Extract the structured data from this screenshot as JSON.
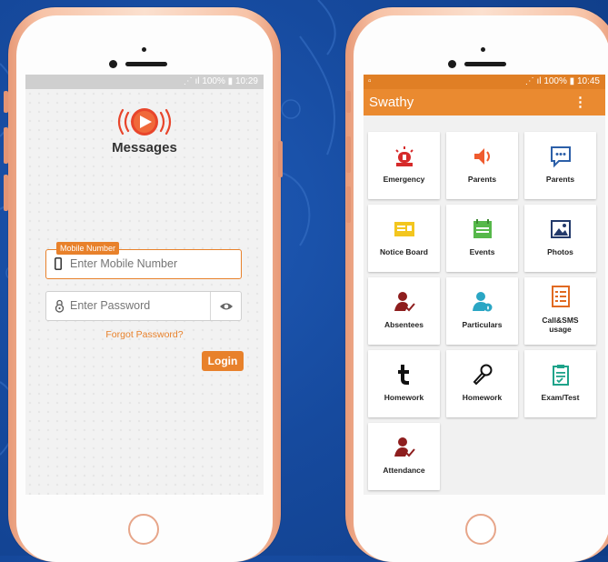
{
  "login_phone": {
    "status": {
      "battery": "100%",
      "time": "10:29"
    },
    "app_name": "Messages",
    "mobile": {
      "tag": "Mobile Number",
      "placeholder": "Enter Mobile Number"
    },
    "password": {
      "placeholder": "Enter Password"
    },
    "forgot_label": "Forgot Password?",
    "login_label": "Login",
    "accent_color": "#e8812b"
  },
  "dash_phone": {
    "status": {
      "battery": "100%",
      "time": "10:45"
    },
    "title": "Swathy",
    "menu": "⋮",
    "tiles": [
      {
        "label": "Emergency",
        "icon": "siren-icon"
      },
      {
        "label": "Parents",
        "icon": "speaker-icon"
      },
      {
        "label": "Parents",
        "icon": "chat-icon"
      },
      {
        "label": "Notice Board",
        "icon": "notice-board-icon"
      },
      {
        "label": "Events",
        "icon": "calendar-icon"
      },
      {
        "label": "Photos",
        "icon": "photos-icon"
      },
      {
        "label": "Absentees",
        "icon": "absentee-user-icon"
      },
      {
        "label": "Particulars",
        "icon": "user-info-icon"
      },
      {
        "label": "Call&SMS\nusage",
        "icon": "list-icon"
      },
      {
        "label": "Homework",
        "icon": "tumblr-t-icon"
      },
      {
        "label": "Homework",
        "icon": "microphone-icon"
      },
      {
        "label": "Exam/Test",
        "icon": "clipboard-icon"
      },
      {
        "label": "Attendance",
        "icon": "attendance-user-icon"
      }
    ],
    "accent_color": "#ea8a30"
  }
}
